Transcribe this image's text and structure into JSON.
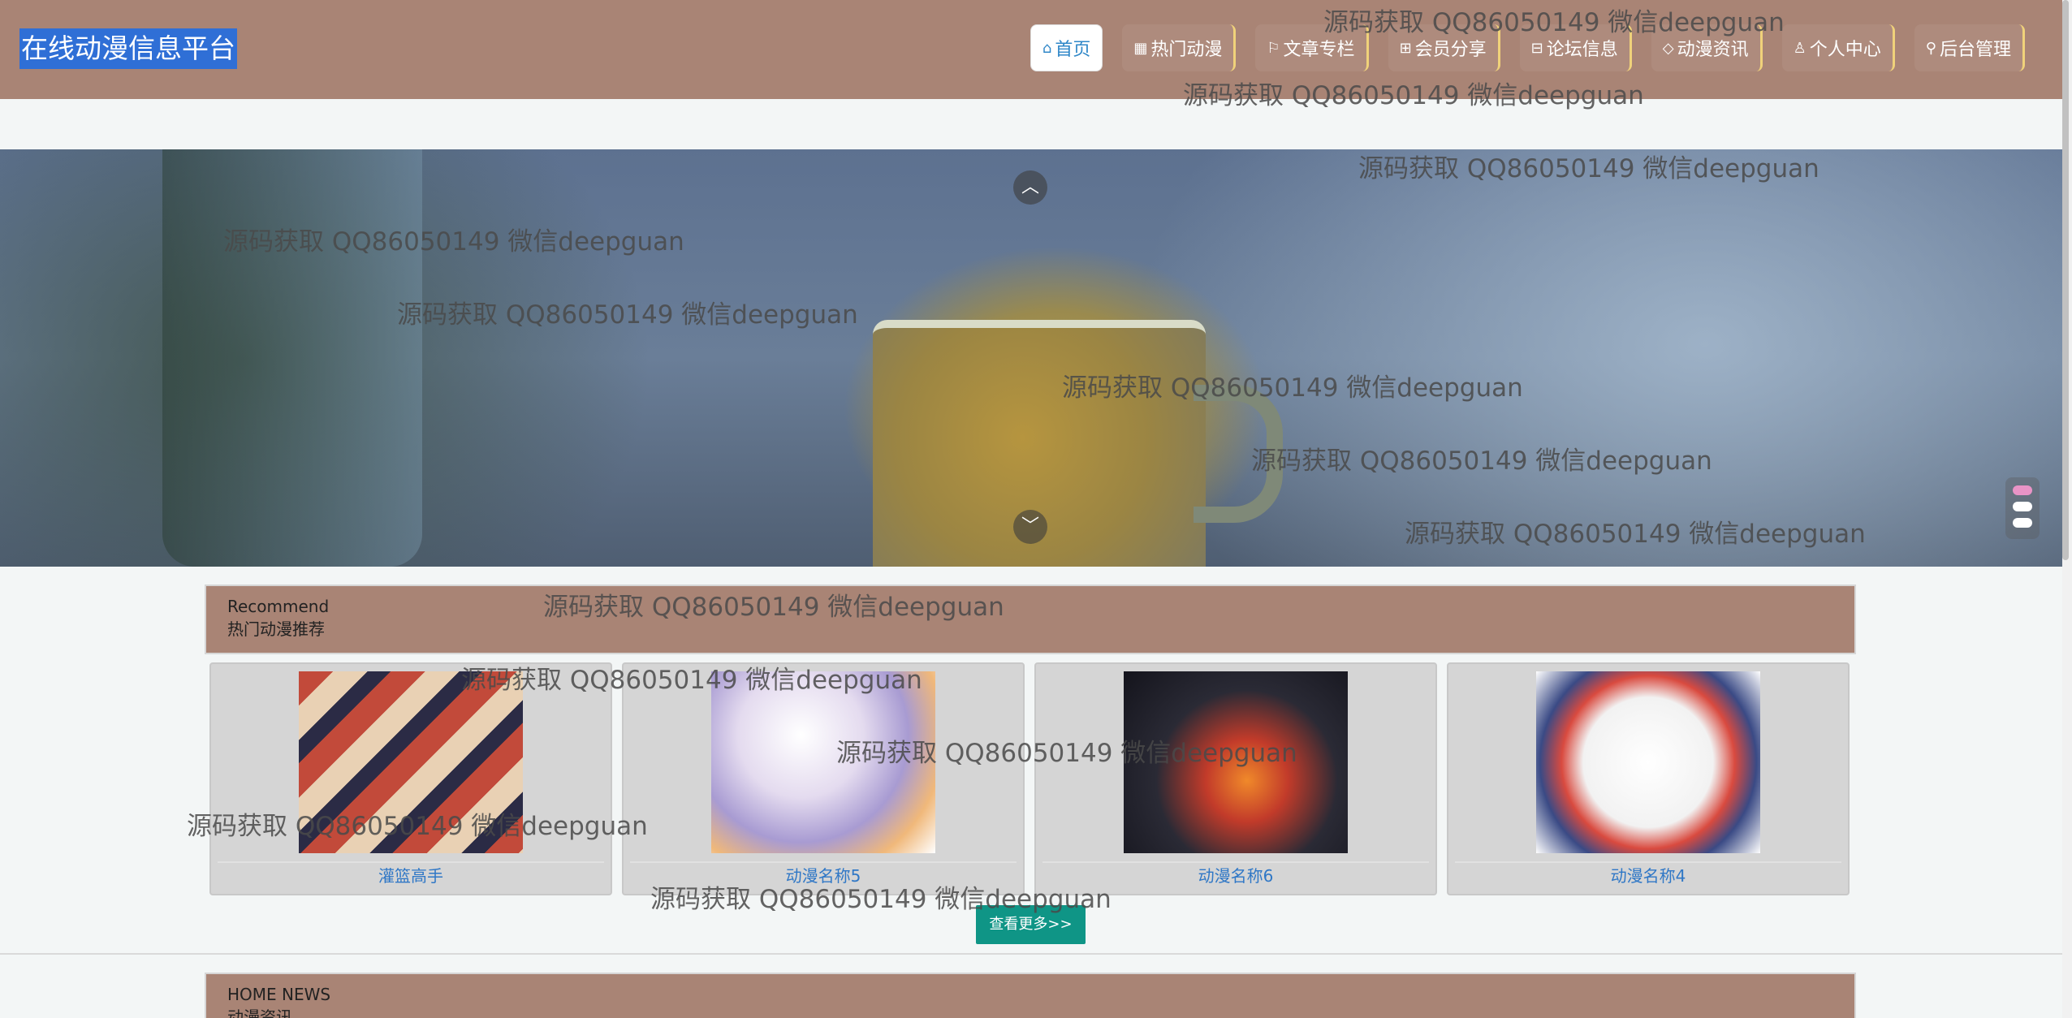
{
  "header": {
    "logo": "在线动漫信息平台",
    "nav": [
      {
        "label": "首页",
        "icon": "⌂"
      },
      {
        "label": "热门动漫",
        "icon": "▦"
      },
      {
        "label": "文章专栏",
        "icon": "⚐"
      },
      {
        "label": "会员分享",
        "icon": "⊞"
      },
      {
        "label": "论坛信息",
        "icon": "⊟"
      },
      {
        "label": "动漫资讯",
        "icon": "◇"
      },
      {
        "label": "个人中心",
        "icon": "♙"
      },
      {
        "label": "后台管理",
        "icon": "⚲"
      }
    ]
  },
  "banner": {
    "up_icon": "︿",
    "down_icon": "﹀"
  },
  "recommend": {
    "en": "Recommend",
    "cn": "热门动漫推荐",
    "items": [
      {
        "name": "灌篮高手"
      },
      {
        "name": "动漫名称5"
      },
      {
        "name": "动漫名称6"
      },
      {
        "name": "动漫名称4"
      }
    ],
    "more": "查看更多>>"
  },
  "news": {
    "en": "HOME NEWS",
    "cn": "动漫资讯"
  },
  "watermark": "源码获取 QQ86050149 微信deepguan"
}
